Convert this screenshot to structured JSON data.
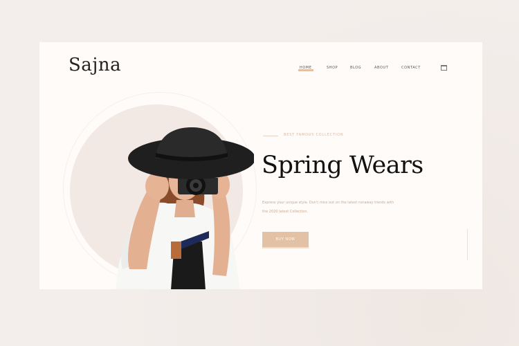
{
  "brand": {
    "logo": "Sajna"
  },
  "nav": {
    "items": [
      {
        "label": "HOME",
        "active": true
      },
      {
        "label": "SHOP",
        "active": false
      },
      {
        "label": "BLOG",
        "active": false
      },
      {
        "label": "ABOUT",
        "active": false
      },
      {
        "label": "CONTACT",
        "active": false
      }
    ],
    "cart_icon": "shopping-bag-icon"
  },
  "hero": {
    "subtitle": "BEST FAMOUS COLLECTION",
    "title": "Spring Wears",
    "description": "Express your unique style. Don't miss out on the latest runaway trends with the 2020 latest Collection.",
    "cta_label": "BUY NOW"
  },
  "colors": {
    "page_bg": "#f3eeeb",
    "card_bg": "#fffbf9",
    "accent": "#e3c1a5",
    "circle": "#f2e8e4",
    "text_dark": "#111111"
  }
}
